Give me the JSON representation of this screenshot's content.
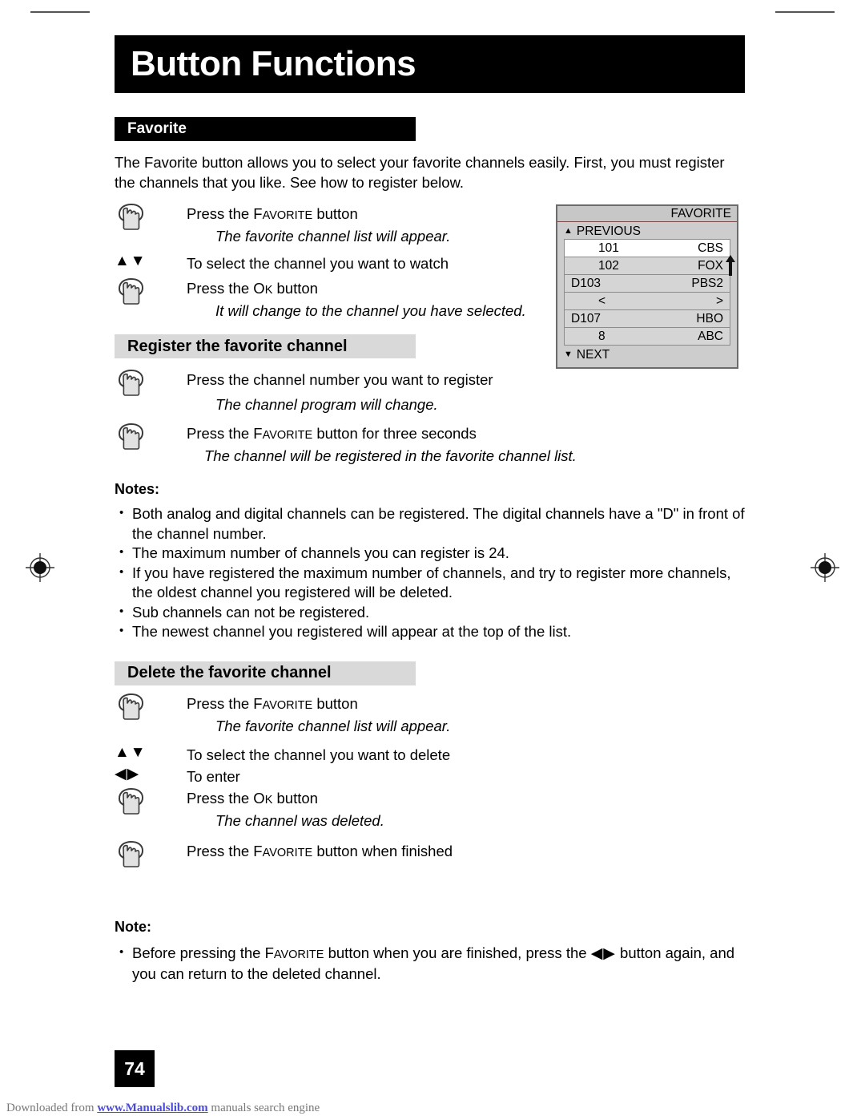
{
  "page": {
    "title": "Button Functions",
    "number": "74"
  },
  "favorite_section": {
    "heading": "Favorite",
    "intro": "The Favorite button allows you to select your favorite channels easily.  First, you must register the channels that you like.  See how to register below.",
    "steps": [
      {
        "icon": "hand-press-icon",
        "text_prefix": "Press the ",
        "button_name": "FAVORITE",
        "text_suffix": " button",
        "sub_note": "The favorite channel list will appear."
      },
      {
        "icon": "up-down-arrows-icon",
        "arrows": "▲▼",
        "text_prefix": "To select the channel you want to watch",
        "button_name": "",
        "text_suffix": "",
        "sub_note": ""
      },
      {
        "icon": "hand-press-icon",
        "text_prefix": "Press the ",
        "button_name": "OK",
        "text_suffix": " button",
        "sub_note": "It will change to the channel you have selected."
      }
    ]
  },
  "register_section": {
    "heading": "Register the favorite channel",
    "steps": [
      {
        "icon": "hand-press-icon",
        "text_prefix": "Press the channel number you want to register",
        "button_name": "",
        "text_suffix": "",
        "sub_note": "The channel program will change."
      },
      {
        "icon": "hand-press-icon",
        "text_prefix": "Press the ",
        "button_name": "FAVORITE",
        "text_suffix": " button for three seconds",
        "sub_note": "The channel will be registered in the favorite channel list."
      }
    ]
  },
  "notes_block": {
    "heading": "Notes:",
    "items": [
      "Both analog and digital channels can be registered.  The digital channels have a \"D\" in front of the channel number.",
      "The maximum number of channels you can register is 24.",
      "If you have registered the maximum number of channels, and try to register more channels, the oldest channel you registered will be deleted.",
      "Sub channels can not be registered.",
      "The newest channel you registered will appear at the top of the list."
    ]
  },
  "delete_section": {
    "heading": "Delete the favorite channel",
    "steps": [
      {
        "icon": "hand-press-icon",
        "text_prefix": "Press the ",
        "button_name": "FAVORITE",
        "text_suffix": " button",
        "sub_note": "The favorite channel list will appear."
      },
      {
        "icon": "up-down-arrows-icon",
        "arrows": "▲▼",
        "text_prefix": "To select the channel you want to delete",
        "button_name": "",
        "text_suffix": "",
        "sub_note": ""
      },
      {
        "icon": "left-right-arrows-icon",
        "arrows": "◀▶",
        "text_prefix": "To enter",
        "button_name": "",
        "text_suffix": "",
        "sub_note": ""
      },
      {
        "icon": "hand-press-icon",
        "text_prefix": "Press the ",
        "button_name": "OK",
        "text_suffix": " button",
        "sub_note": "The channel was deleted."
      },
      {
        "icon": "hand-press-icon",
        "text_prefix": "Press the ",
        "button_name": "FAVORITE",
        "text_suffix": " button when finished",
        "sub_note": ""
      }
    ]
  },
  "note_block": {
    "heading": "Note:",
    "item_part1": "Before pressing the ",
    "item_button": "FAVORITE",
    "item_part2": " button when you are finished, press the ",
    "item_arrows": "◀▶",
    "item_part3": " button again, and you can return to the deleted channel."
  },
  "osd_panel": {
    "title": "FAVORITE",
    "previous_label": "PREVIOUS",
    "next_label": "NEXT",
    "rows": [
      {
        "channel": "101",
        "network": "CBS",
        "selected": true,
        "type": "channel"
      },
      {
        "channel": "102",
        "network": "FOX",
        "selected": false,
        "type": "channel"
      },
      {
        "channel": "D103",
        "network": "PBS2",
        "selected": false,
        "type": "channel"
      },
      {
        "channel": "<",
        "network": ">",
        "selected": false,
        "type": "nav"
      },
      {
        "channel": "D107",
        "network": "HBO",
        "selected": false,
        "type": "channel"
      },
      {
        "channel": "8",
        "network": "ABC",
        "selected": false,
        "type": "channel"
      }
    ]
  },
  "footer": {
    "prefix": "Downloaded from ",
    "link": "www.Manualslib.com",
    "suffix": " manuals search engine"
  }
}
